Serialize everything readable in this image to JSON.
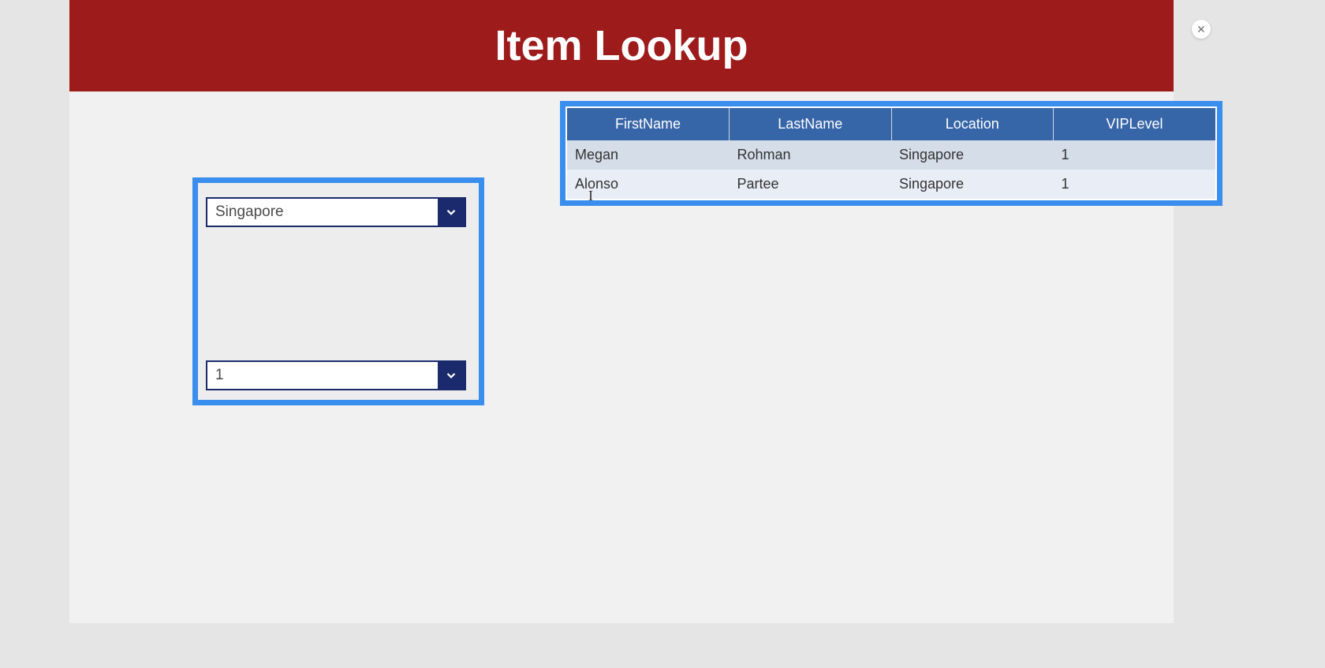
{
  "header": {
    "title": "Item Lookup"
  },
  "filters": {
    "location": {
      "selected": "Singapore"
    },
    "vip_level": {
      "selected": "1"
    }
  },
  "table": {
    "headers": [
      "FirstName",
      "LastName",
      "Location",
      "VIPLevel"
    ],
    "rows": [
      {
        "first_name": "Megan",
        "last_name": "Rohman",
        "location": "Singapore",
        "vip_level": "1"
      },
      {
        "first_name": "Alonso",
        "last_name": "Partee",
        "location": "Singapore",
        "vip_level": "1"
      }
    ]
  }
}
